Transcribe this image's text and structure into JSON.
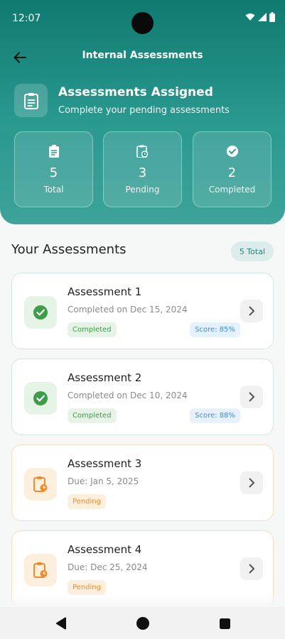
{
  "status_bar": {
    "time": "12:07"
  },
  "appbar": {
    "title": "Internal Assessments"
  },
  "hero": {
    "title": "Assessments Assigned",
    "subtitle": "Complete your pending assessments"
  },
  "stats": [
    {
      "value": "5",
      "label": "Total",
      "icon": "clipboard-icon"
    },
    {
      "value": "3",
      "label": "Pending",
      "icon": "clipboard-clock-icon"
    },
    {
      "value": "2",
      "label": "Completed",
      "icon": "check-circle-icon"
    }
  ],
  "section": {
    "title": "Your Assessments",
    "badge": "5 Total"
  },
  "assessments": [
    {
      "title": "Assessment 1",
      "subtitle": "Completed on Dec 15, 2024",
      "status": "Completed",
      "score": "Score: 85%"
    },
    {
      "title": "Assessment 2",
      "subtitle": "Completed on Dec 10, 2024",
      "status": "Completed",
      "score": "Score: 88%"
    },
    {
      "title": "Assessment 3",
      "subtitle": "Due: Jan 5, 2025",
      "status": "Pending"
    },
    {
      "title": "Assessment 4",
      "subtitle": "Due: Dec 25, 2024",
      "status": "Pending"
    }
  ],
  "colors": {
    "primary": "#1f8c82",
    "completed": "#3f9c48",
    "pending": "#ef8b2a",
    "score": "#3b8ce0"
  }
}
